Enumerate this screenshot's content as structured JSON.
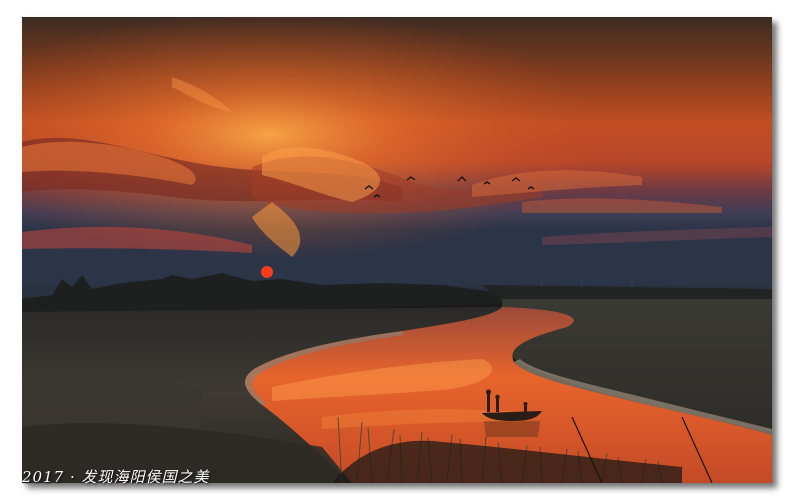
{
  "photo": {
    "subject": "sunset-wetland-river",
    "caption": "2017 · 发现海阳侯国之美"
  },
  "colors": {
    "sky_top": "#3a2a22",
    "sky_mid": "#c8552a",
    "sky_glow": "#f08a3a",
    "sky_horizon": "#6a4a5a",
    "water": "#e0602e",
    "land": "#2a2824",
    "reeds": "#5a5448"
  }
}
